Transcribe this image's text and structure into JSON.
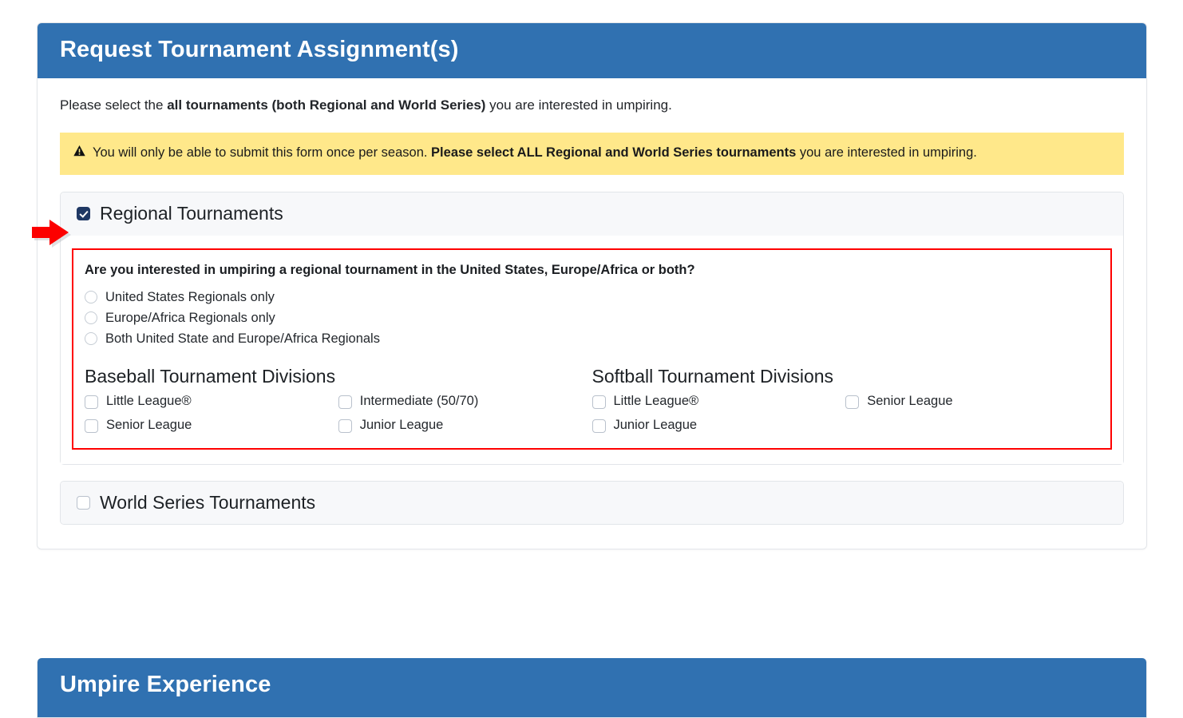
{
  "colors": {
    "header_blue": "#3071B1",
    "alert_yellow": "#FFE88A",
    "highlight_red": "#FF0000",
    "checkbox_checked": "#1F3864",
    "section_head_bg": "#F7F8FA"
  },
  "card": {
    "header_title": "Request Tournament Assignment(s)",
    "intro": {
      "before": "Please select the ",
      "bold": "all tournaments (both Regional and World Series)",
      "after": " you are interested in umpiring."
    },
    "alert": {
      "icon": "warning-triangle-icon",
      "before": "You will only be able to submit this form once per season. ",
      "bold": "Please select ALL Regional and World Series tournaments",
      "after": " you are interested in umpiring."
    },
    "sections": [
      {
        "id": "regional-tournaments",
        "title": "Regional Tournaments",
        "checked": true,
        "expanded": true,
        "question": "Are you interested in umpiring a regional tournament in the United States, Europe/Africa or both?",
        "radios": [
          {
            "label": "United States Regionals only",
            "selected": false
          },
          {
            "label": "Europe/Africa Regionals only",
            "selected": false
          },
          {
            "label": "Both United State and Europe/Africa Regionals",
            "selected": false
          }
        ],
        "divisions": [
          {
            "id": "baseball",
            "heading": "Baseball Tournament Divisions",
            "options": [
              {
                "label": "Little League®",
                "checked": false
              },
              {
                "label": "Intermediate (50/70)",
                "checked": false
              },
              {
                "label": "Senior League",
                "checked": false
              },
              {
                "label": "Junior League",
                "checked": false
              }
            ]
          },
          {
            "id": "softball",
            "heading": "Softball Tournament Divisions",
            "options": [
              {
                "label": "Little League®",
                "checked": false
              },
              {
                "label": "Senior League",
                "checked": false
              },
              {
                "label": "Junior League",
                "checked": false
              }
            ]
          }
        ]
      },
      {
        "id": "world-series-tournaments",
        "title": "World Series Tournaments",
        "checked": false,
        "expanded": false
      }
    ]
  },
  "card2": {
    "header_title": "Umpire Experience"
  },
  "annotation": {
    "arrow": "red-pointer-arrow",
    "arrow_target": "regional-tournaments-checkbox"
  }
}
